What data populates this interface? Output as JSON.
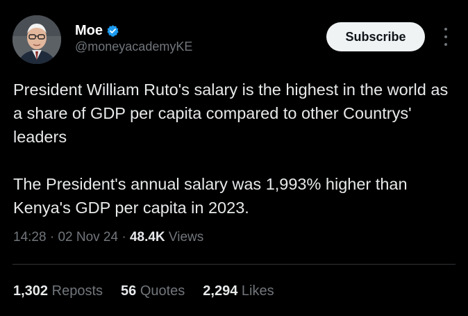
{
  "author": {
    "name": "Moe",
    "handle": "@moneyacademyKE",
    "verified_color": "#1d9bf0",
    "avatar_icon": "avatar"
  },
  "actions": {
    "subscribe_label": "Subscribe",
    "more_icon": "more-vertical-icon"
  },
  "post": {
    "paragraph1": "President William Ruto's salary is the highest in the world as a share of GDP per capita compared to other Countrys' leaders",
    "paragraph2": "The President's annual salary was 1,993% higher than Kenya's GDP per capita in 2023."
  },
  "meta": {
    "time": "14:28",
    "sep1": " · ",
    "date": "02 Nov 24",
    "sep2": " · ",
    "views_count": "48.4K",
    "views_label": " Views"
  },
  "stats": {
    "reposts_count": "1,302",
    "reposts_label": "Reposts",
    "quotes_count": "56",
    "quotes_label": "Quotes",
    "likes_count": "2,294",
    "likes_label": "Likes"
  }
}
